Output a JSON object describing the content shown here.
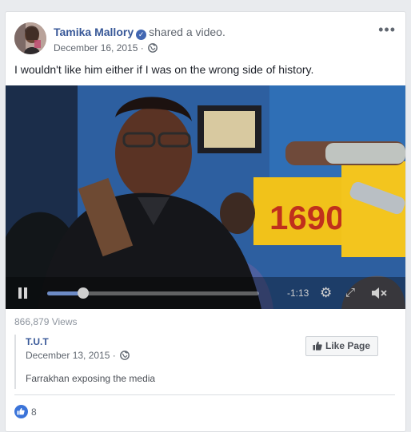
{
  "post": {
    "author": "Tamika Mallory",
    "action": "shared a video.",
    "date": "December 16, 2015 · ",
    "more_label": "•••",
    "message": "I wouldn't like him either if I was on the wrong side of history."
  },
  "video": {
    "station_sign": "1690",
    "time_remaining": "-1:13",
    "progress": 0.17
  },
  "views": "866,879 Views",
  "source": {
    "name": "T.U.T",
    "date": "December 13, 2015 · ",
    "description": "Farrakhan exposing the media",
    "like_page_label": "Like Page"
  },
  "reactions": {
    "count": "8"
  },
  "colors": {
    "link": "#385898",
    "accent": "#4267b2"
  },
  "icons": {
    "verified": "verified-badge-icon",
    "globe": "globe-icon",
    "pause": "pause-icon",
    "settings": "gear-icon",
    "fullscreen": "fullscreen-icon",
    "mute": "mute-icon",
    "like": "thumbs-up-icon"
  }
}
